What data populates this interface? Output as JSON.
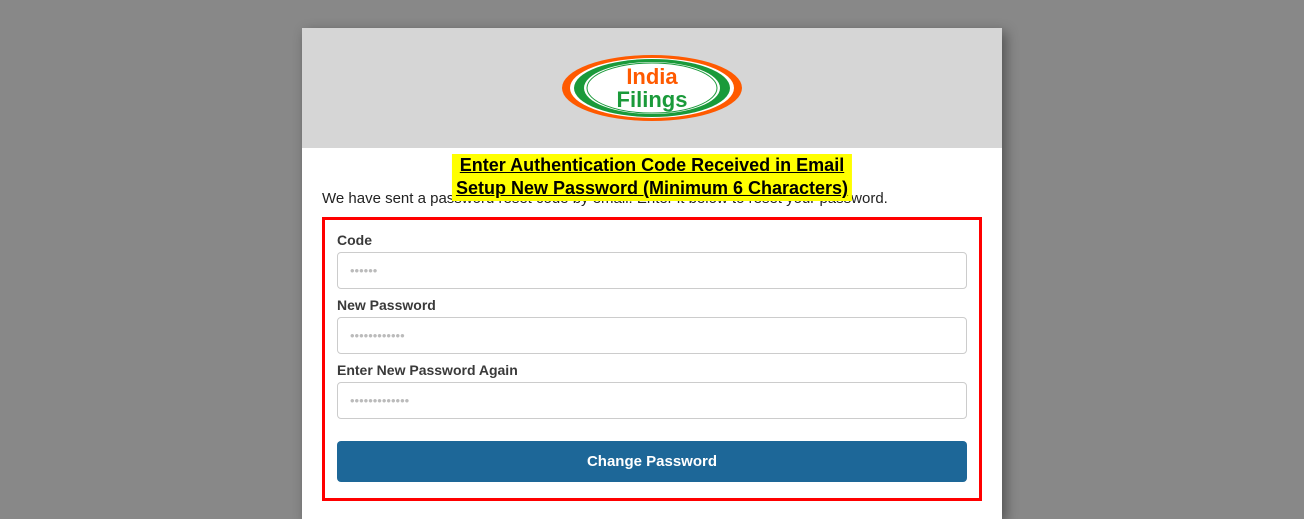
{
  "logo": {
    "line1": "India",
    "line2": "Filings"
  },
  "banner": {
    "line1": "Enter Authentication Code Received in Email",
    "line2": "Setup New Password (Minimum 6 Characters)"
  },
  "intro_text": "We have sent a password reset code by email. Enter it below to reset your password.",
  "form": {
    "code_label": "Code",
    "code_placeholder": "••••••",
    "newpw_label": "New Password",
    "newpw_placeholder": "••••••••••••",
    "confirm_label": "Enter New Password Again",
    "confirm_placeholder": "•••••••••••••",
    "submit_label": "Change Password"
  }
}
